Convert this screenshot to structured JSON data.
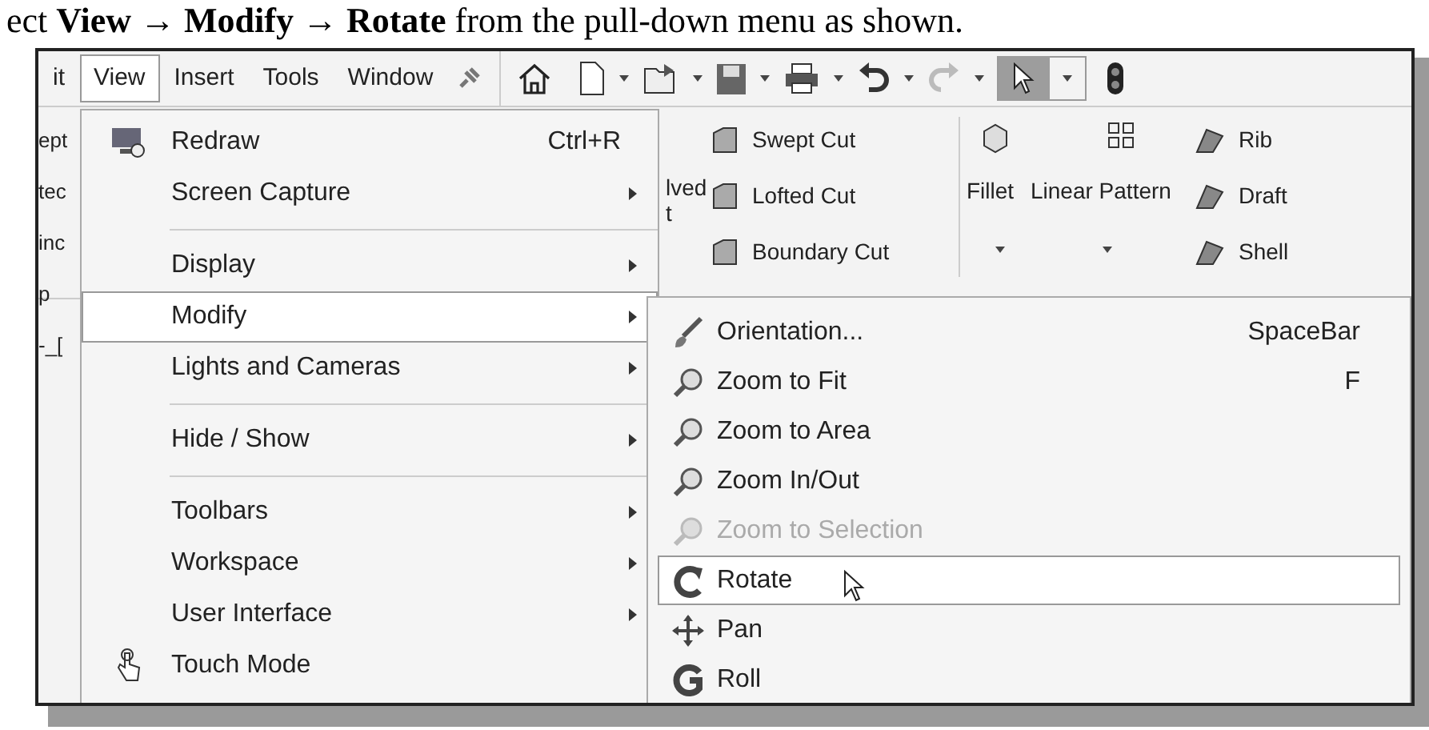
{
  "caption": "ect **View** → **Modify** → **Rotate** from the pull-down menu as shown.",
  "menu_bar": [
    {
      "label": "it",
      "selected": false
    },
    {
      "label": "View",
      "selected": true
    },
    {
      "label": "Insert",
      "selected": false
    },
    {
      "label": "Tools",
      "selected": false
    },
    {
      "label": "Window",
      "selected": false
    }
  ],
  "left_pane": [
    "ept",
    "tec",
    "inc",
    "p",
    "-_["
  ],
  "ribbon": {
    "left": [
      "lved",
      "t"
    ],
    "cuts": [
      "Swept Cut",
      "Lofted Cut",
      "Boundary Cut"
    ],
    "features": [
      "Fillet",
      "Linear Pattern"
    ],
    "right": [
      "Rib",
      "Draft",
      "Shell"
    ]
  },
  "view_menu": [
    {
      "kind": "item",
      "label": "Redraw",
      "shortcut": "Ctrl+R",
      "submenu": false,
      "selected": false
    },
    {
      "kind": "item",
      "label": "Screen Capture",
      "submenu": true,
      "selected": false
    },
    {
      "kind": "separator"
    },
    {
      "kind": "item",
      "label": "Display",
      "submenu": true,
      "selected": false
    },
    {
      "kind": "item",
      "label": "Modify",
      "submenu": true,
      "selected": true
    },
    {
      "kind": "item",
      "label": "Lights and Cameras",
      "submenu": true,
      "selected": false
    },
    {
      "kind": "separator"
    },
    {
      "kind": "item",
      "label": "Hide / Show",
      "submenu": true,
      "selected": false
    },
    {
      "kind": "separator"
    },
    {
      "kind": "item",
      "label": "Toolbars",
      "submenu": true,
      "selected": false
    },
    {
      "kind": "item",
      "label": "Workspace",
      "submenu": true,
      "selected": false
    },
    {
      "kind": "item",
      "label": "User Interface",
      "submenu": true,
      "selected": false
    },
    {
      "kind": "item",
      "label": "Touch Mode",
      "submenu": false,
      "selected": false
    }
  ],
  "modify_menu": [
    {
      "label": "Orientation...",
      "shortcut": "SpaceBar",
      "disabled": false,
      "selected": false
    },
    {
      "label": "Zoom to Fit",
      "shortcut": "F",
      "disabled": false,
      "selected": false
    },
    {
      "label": "Zoom to Area",
      "disabled": false,
      "selected": false
    },
    {
      "label": "Zoom In/Out",
      "disabled": false,
      "selected": false
    },
    {
      "label": "Zoom to Selection",
      "disabled": true,
      "selected": false
    },
    {
      "label": "Rotate",
      "disabled": false,
      "selected": true
    },
    {
      "label": "Pan",
      "disabled": false,
      "selected": false
    },
    {
      "label": "Roll",
      "disabled": false,
      "selected": false
    }
  ]
}
